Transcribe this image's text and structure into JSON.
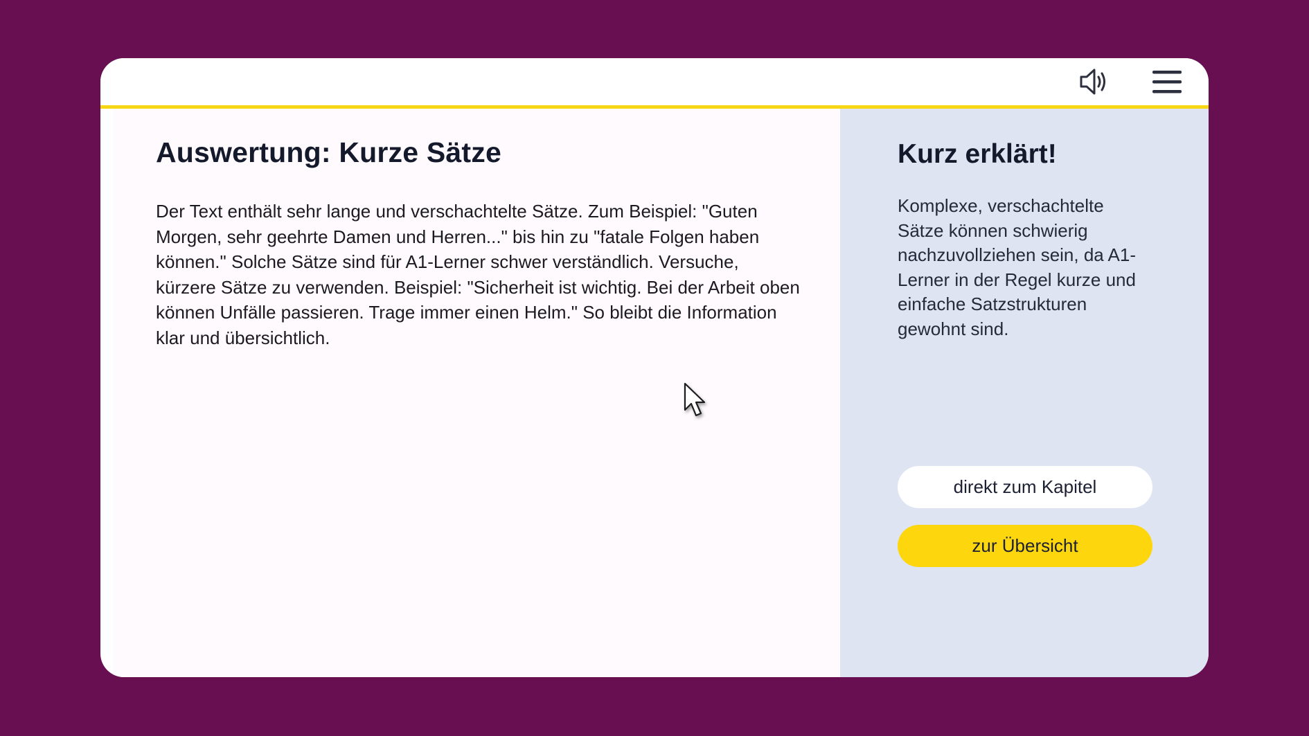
{
  "header": {
    "speaker_icon": "speaker-volume-icon",
    "menu_icon": "hamburger-menu-icon",
    "accent_color": "#f7d616"
  },
  "main": {
    "title": "Auswertung: Kurze Sätze",
    "text": "Der Text enthält sehr lange und verschachtelte Sätze. Zum Beispiel: \"Guten Morgen, sehr geehrte Damen und Herren...\" bis hin zu \"fatale Folgen haben können.\" Solche Sätze sind für A1-Lerner schwer verständlich. Versuche, kürzere Sätze zu verwenden. Beispiel: \"Sicherheit ist wichtig. Bei der Arbeit oben können Unfälle passieren. Trage immer einen Helm.\" So bleibt die Information klar und übersichtlich."
  },
  "side": {
    "title": "Kurz erklärt!",
    "text": "Komplexe, verschachtelte Sätze können schwierig nachzuvollziehen sein, da A1-Lerner in der Regel kurze und einfache Satzstrukturen gewohnt sind.",
    "chapter_button": "direkt zum Kapitel",
    "overview_button": "zur Übersicht",
    "overview_button_color": "#fdd60d"
  },
  "colors": {
    "background": "#680f51",
    "side_panel": "#dfe4f3"
  }
}
